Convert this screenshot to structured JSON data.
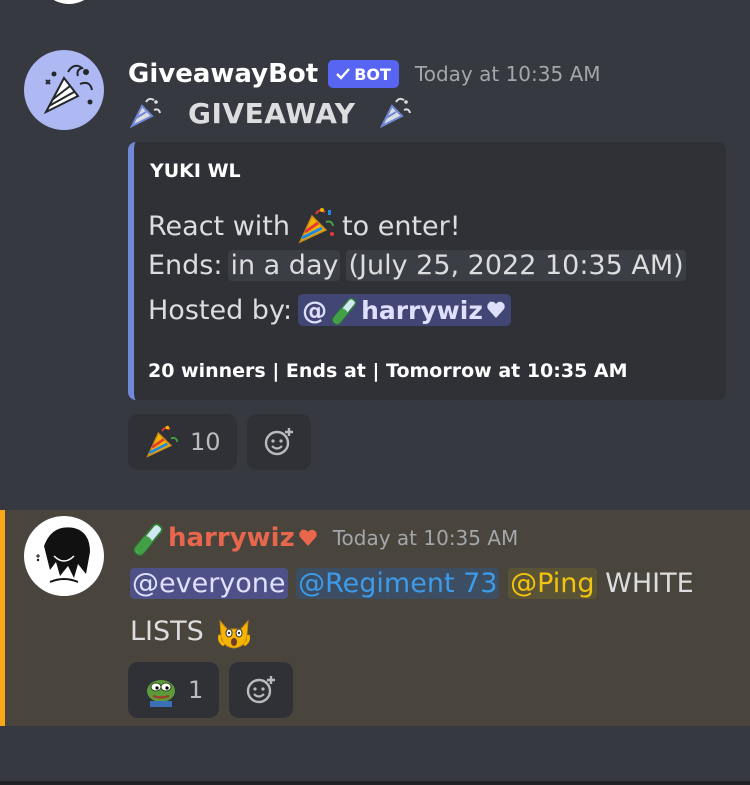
{
  "message1": {
    "author": "GiveawayBot",
    "bot_tag": "BOT",
    "timestamp": "Today at 10:35 AM",
    "heading": "GIVEAWAY",
    "embed": {
      "title": "YUKI WL",
      "react_prefix": "React with",
      "react_suffix": "to enter!",
      "ends_label": "Ends:",
      "ends_relative": "in a day",
      "ends_absolute": "(July 25, 2022 10:35 AM)",
      "hosted_label": "Hosted by:",
      "host_mention_prefix": "@",
      "host_name": "harrywiz",
      "footer": "20 winners | Ends at | Tomorrow at 10:35 AM"
    },
    "reactions": [
      {
        "emoji": "party-popper",
        "count": "10"
      }
    ]
  },
  "message2": {
    "author": "harrywiz",
    "timestamp": "Today at 10:35 AM",
    "mention_everyone": "@everyone",
    "mention_role1": "@Regiment 73",
    "mention_role2": "@Ping",
    "text_after": "WHITE",
    "text_line2": "LISTS",
    "reactions": [
      {
        "emoji": "pepe",
        "count": "1"
      }
    ]
  },
  "colors": {
    "background": "#36393f",
    "embed_bar": "#7289da",
    "bot_tag": "#5865f2",
    "highlight_bar": "#faa81a",
    "highlight_bg": "#49443c",
    "author2_color": "#e8674c"
  }
}
